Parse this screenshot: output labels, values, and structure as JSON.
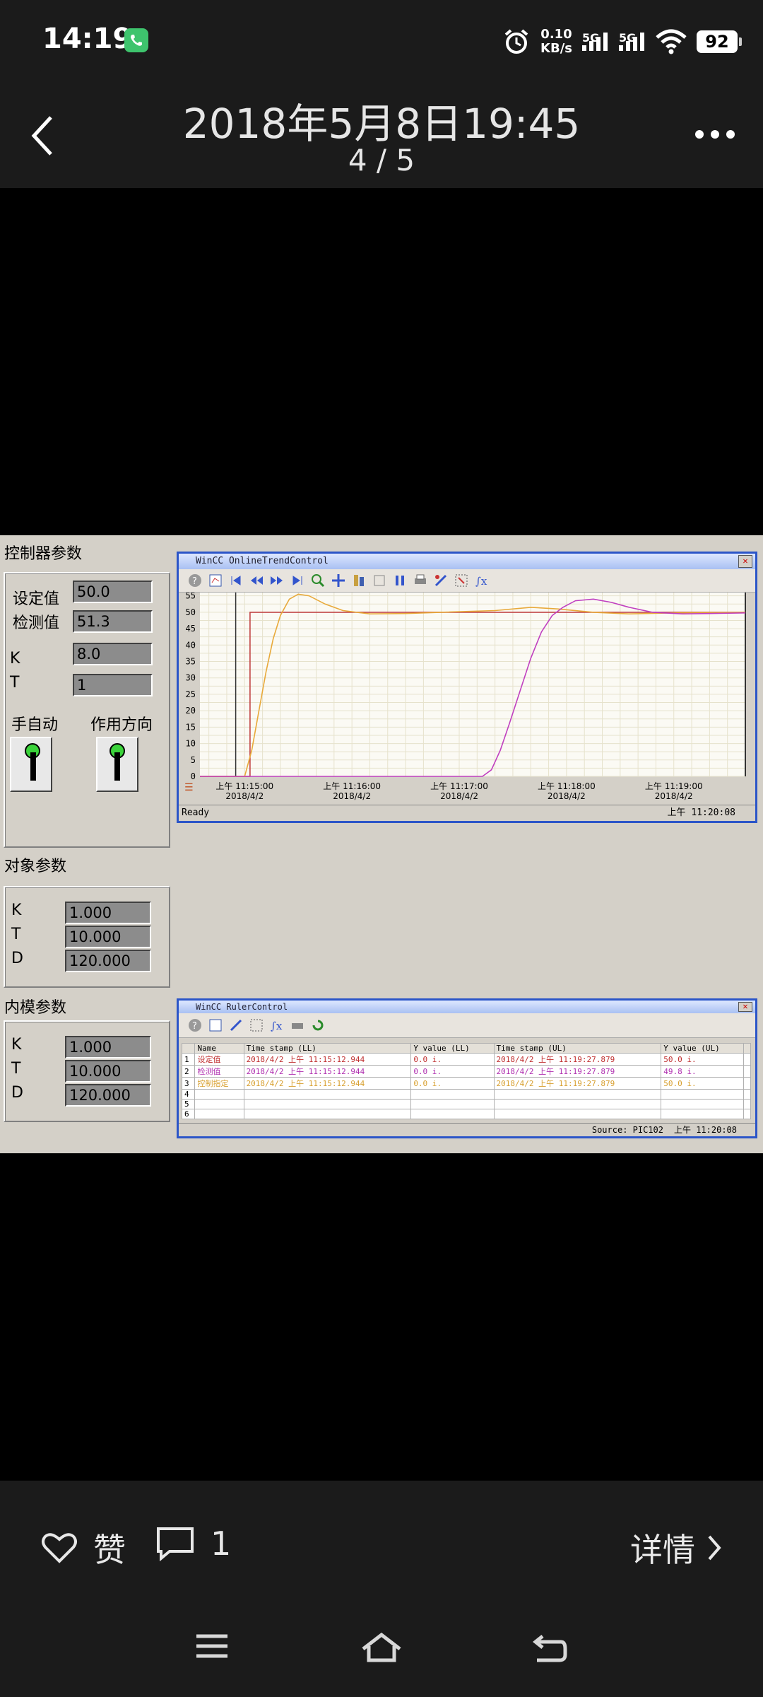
{
  "status": {
    "time": "14:19",
    "net_speed_value": "0.10",
    "net_speed_unit": "KB/s",
    "sig1": "5G",
    "sig2": "5G",
    "battery": "92"
  },
  "header": {
    "title": "2018年5月8日19:45",
    "counter": "4 / 5"
  },
  "photo": {
    "controller": {
      "title": "控制器参数",
      "sv_label": "设定值",
      "sv": "50.0",
      "pv_label": "检测值",
      "pv": "51.3",
      "k_label": "K",
      "k": "8.0",
      "t_label": "T",
      "t": "1",
      "manual_auto": "手自动",
      "direction": "作用方向"
    },
    "object": {
      "title": "对象参数",
      "k_label": "K",
      "k": "1.000",
      "t_label": "T",
      "t": "10.000",
      "d_label": "D",
      "d": "120.000"
    },
    "internal": {
      "title": "内模参数",
      "k_label": "K",
      "k": "1.000",
      "t_label": "T",
      "t": "10.000",
      "d_label": "D",
      "d": "120.000"
    },
    "trend": {
      "title": "WinCC OnlineTrendControl",
      "status": "Ready",
      "time": "上午 11:20:08"
    },
    "ruler": {
      "title": "WinCC RulerControl",
      "headers": [
        "",
        "Name",
        "Time stamp (LL)",
        "Y value (LL)",
        "Time stamp (UL)",
        "Y value (UL)",
        ""
      ],
      "rows": [
        [
          "1",
          "设定值",
          "2018/4/2 上午 11:15:12.944",
          "0.0 i.",
          "2018/4/2 上午 11:19:27.879",
          "50.0 i.",
          ""
        ],
        [
          "2",
          "检测值",
          "2018/4/2 上午 11:15:12.944",
          "0.0 i.",
          "2018/4/2 上午 11:19:27.879",
          "49.8 i.",
          ""
        ],
        [
          "3",
          "控制指定",
          "2018/4/2 上午 11:15:12.944",
          "0.0 i.",
          "2018/4/2 上午 11:19:27.879",
          "50.0 i.",
          ""
        ],
        [
          "4",
          "",
          "",
          "",
          "",
          "",
          ""
        ],
        [
          "5",
          "",
          "",
          "",
          "",
          "",
          ""
        ],
        [
          "6",
          "",
          "",
          "",
          "",
          "",
          ""
        ]
      ],
      "source": "Source: PIC102",
      "time": "上午 11:20:08"
    }
  },
  "chart_data": {
    "type": "line",
    "ylim": [
      0,
      56
    ],
    "yticks": [
      0,
      5,
      10,
      15,
      20,
      25,
      30,
      35,
      40,
      45,
      50,
      55
    ],
    "xticks": [
      {
        "t": 0,
        "label1": "上午 11:15:00",
        "label2": "2018/4/2"
      },
      {
        "t": 60,
        "label1": "上午 11:16:00",
        "label2": "2018/4/2"
      },
      {
        "t": 120,
        "label1": "上午 11:17:00",
        "label2": "2018/4/2"
      },
      {
        "t": 180,
        "label1": "上午 11:18:00",
        "label2": "2018/4/2"
      },
      {
        "t": 240,
        "label1": "上午 11:19:00",
        "label2": "2018/4/2"
      }
    ],
    "xlim": [
      -25,
      280
    ],
    "series": [
      {
        "color": "#c04040",
        "points": [
          [
            -25,
            0
          ],
          [
            3,
            0
          ],
          [
            3,
            50
          ],
          [
            280,
            50
          ]
        ]
      },
      {
        "color": "#e8a93a",
        "points": [
          [
            -25,
            0
          ],
          [
            0,
            0
          ],
          [
            4,
            8
          ],
          [
            8,
            20
          ],
          [
            12,
            32
          ],
          [
            16,
            42
          ],
          [
            20,
            49
          ],
          [
            25,
            54
          ],
          [
            30,
            55.5
          ],
          [
            36,
            55
          ],
          [
            45,
            52.5
          ],
          [
            55,
            50.5
          ],
          [
            70,
            49.5
          ],
          [
            90,
            49.6
          ],
          [
            110,
            50
          ],
          [
            140,
            50.5
          ],
          [
            160,
            51.5
          ],
          [
            175,
            51
          ],
          [
            195,
            50
          ],
          [
            215,
            49.5
          ],
          [
            240,
            49.8
          ],
          [
            280,
            50
          ]
        ]
      },
      {
        "color": "#c040c0",
        "points": [
          [
            -25,
            0
          ],
          [
            133,
            0
          ],
          [
            138,
            2
          ],
          [
            143,
            8
          ],
          [
            148,
            16
          ],
          [
            154,
            26
          ],
          [
            160,
            36
          ],
          [
            166,
            44
          ],
          [
            172,
            49
          ],
          [
            178,
            51.5
          ],
          [
            185,
            53.5
          ],
          [
            195,
            54
          ],
          [
            205,
            53
          ],
          [
            215,
            51.5
          ],
          [
            228,
            50
          ],
          [
            245,
            49.5
          ],
          [
            260,
            49.6
          ],
          [
            280,
            49.8
          ]
        ]
      }
    ]
  }
}
